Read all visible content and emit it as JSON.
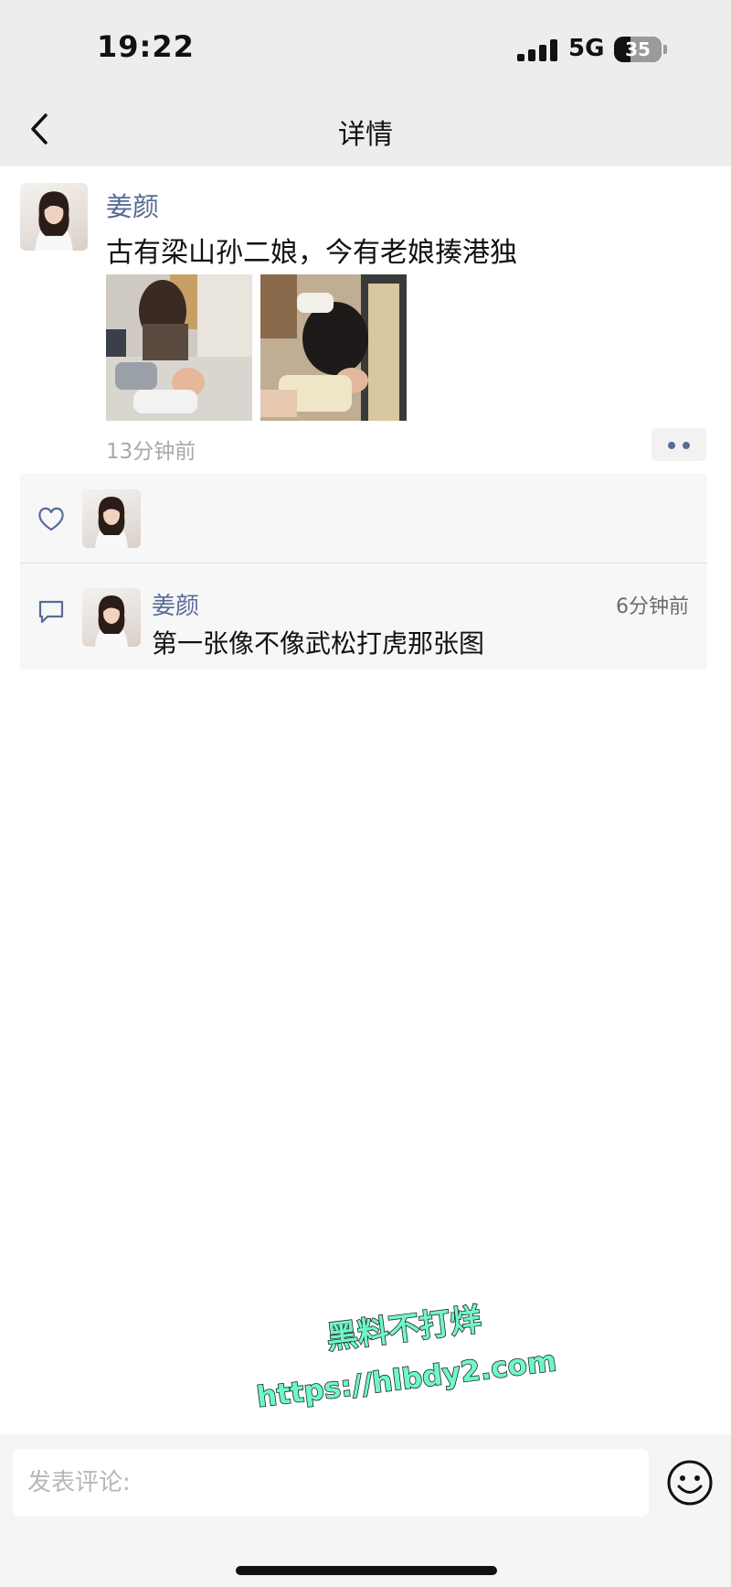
{
  "status_bar": {
    "time": "19:22",
    "network": "5G",
    "battery": "35",
    "battery_level": 0.35
  },
  "nav": {
    "title": "详情",
    "back_icon": "chevron-left-icon"
  },
  "post": {
    "author": "姜颜",
    "text": "古有梁山孙二娘，今有老娘揍港独",
    "time": "13分钟前",
    "photo_count": 2
  },
  "likes": {
    "icon": "heart-outline-icon",
    "count": 1
  },
  "comments": [
    {
      "author": "姜颜",
      "time": "6分钟前",
      "text": "第一张像不像武松打虎那张图"
    }
  ],
  "watermark": {
    "line1": "黑料不打烊",
    "line2": "https://hlbdy2.com"
  },
  "composer": {
    "placeholder": "发表评论:",
    "emoji_icon": "emoji-icon"
  },
  "colors": {
    "bar_bg": "#ededed",
    "link_blue": "#576b95",
    "watermark_fill": "#6ef7c8"
  }
}
